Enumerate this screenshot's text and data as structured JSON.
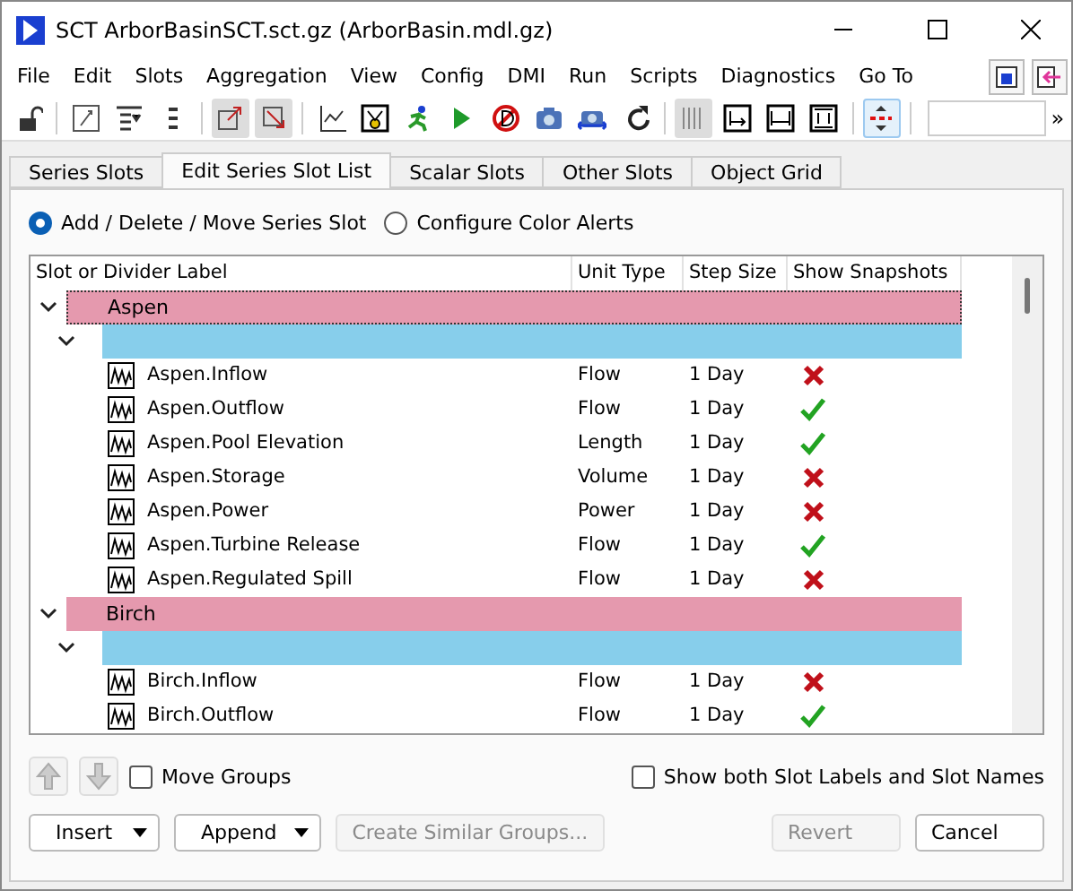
{
  "window": {
    "title": "SCT ArborBasinSCT.sct.gz (ArborBasin.mdl.gz)"
  },
  "menu": [
    "File",
    "Edit",
    "Slots",
    "Aggregation",
    "View",
    "Config",
    "DMI",
    "Run",
    "Scripts",
    "Diagnostics",
    "Go To"
  ],
  "toolbar": {
    "overflow": "»"
  },
  "tabs": [
    {
      "label": "Series Slots",
      "selected": false
    },
    {
      "label": "Edit Series Slot List",
      "selected": true
    },
    {
      "label": "Scalar Slots",
      "selected": false
    },
    {
      "label": "Other Slots",
      "selected": false
    },
    {
      "label": "Object Grid",
      "selected": false
    }
  ],
  "modes": [
    {
      "label": "Add / Delete / Move Series Slot",
      "selected": true
    },
    {
      "label": "Configure Color Alerts",
      "selected": false
    }
  ],
  "table": {
    "columns": [
      "Slot or Divider Label",
      "Unit Type",
      "Step Size",
      "Show Snapshots"
    ],
    "groups": [
      {
        "label": "Aspen",
        "expanded": true,
        "children": [
          {
            "expanded": true,
            "children": [
              {
                "label": "Aspen.Inflow",
                "unit": "Flow",
                "step": "1 Day",
                "snapshot": false
              },
              {
                "label": "Aspen.Outflow",
                "unit": "Flow",
                "step": "1 Day",
                "snapshot": true
              },
              {
                "label": "Aspen.Pool Elevation",
                "unit": "Length",
                "step": "1 Day",
                "snapshot": true
              },
              {
                "label": "Aspen.Storage",
                "unit": "Volume",
                "step": "1 Day",
                "snapshot": false
              },
              {
                "label": "Aspen.Power",
                "unit": "Power",
                "step": "1 Day",
                "snapshot": false
              },
              {
                "label": "Aspen.Turbine Release",
                "unit": "Flow",
                "step": "1 Day",
                "snapshot": true
              },
              {
                "label": "Aspen.Regulated Spill",
                "unit": "Flow",
                "step": "1 Day",
                "snapshot": false
              }
            ]
          }
        ]
      },
      {
        "label": "Birch",
        "expanded": true,
        "children": [
          {
            "expanded": true,
            "children": [
              {
                "label": "Birch.Inflow",
                "unit": "Flow",
                "step": "1 Day",
                "snapshot": false
              },
              {
                "label": "Birch.Outflow",
                "unit": "Flow",
                "step": "1 Day",
                "snapshot": true
              }
            ]
          }
        ]
      }
    ]
  },
  "options": [
    {
      "label": "Move Groups",
      "checked": false
    },
    {
      "label": "Show both Slot Labels and Slot Names",
      "checked": false
    }
  ],
  "buttons": [
    {
      "label": "Insert",
      "kind": "dropdown",
      "disabled": false
    },
    {
      "label": "Append",
      "kind": "dropdown",
      "disabled": false
    },
    {
      "label": "Create Similar Groups...",
      "kind": "plain",
      "disabled": true
    },
    {
      "label": "Revert",
      "kind": "plain",
      "disabled": true
    },
    {
      "label": "Cancel",
      "kind": "plain",
      "disabled": false
    }
  ]
}
